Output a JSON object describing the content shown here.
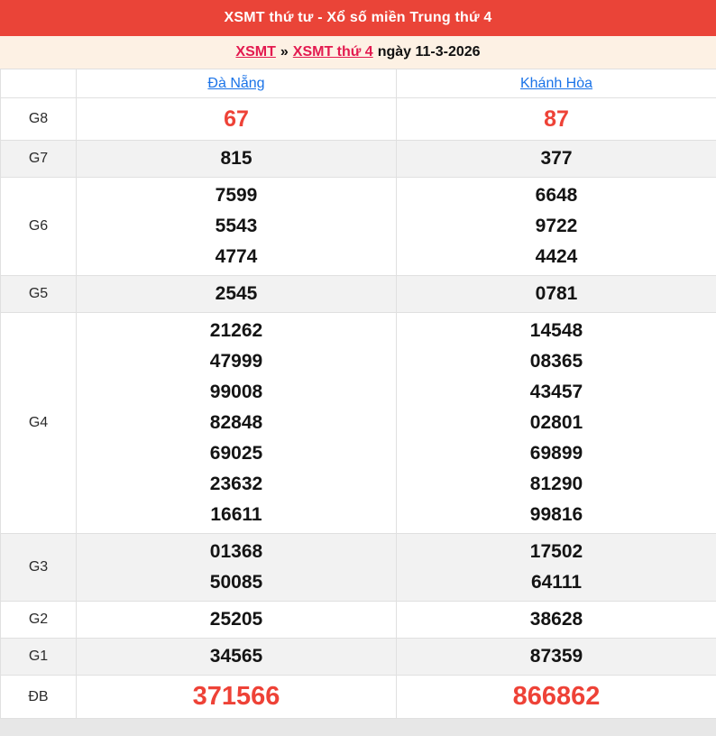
{
  "header": {
    "title": "XSMT thứ tư - Xổ số miền Trung thứ 4"
  },
  "breadcrumb": {
    "region_link": "XSMT",
    "separator": "»",
    "day_link": "XSMT thứ 4",
    "date_text": "ngày 11-3-2026"
  },
  "table": {
    "columns": [
      "Đà Nẵng",
      "Khánh Hòa"
    ],
    "rows": [
      {
        "id": "G8",
        "label": "G8",
        "red": true,
        "size": "large",
        "cells": [
          [
            "67"
          ],
          [
            "87"
          ]
        ]
      },
      {
        "id": "G7",
        "label": "G7",
        "red": false,
        "size": "normal",
        "cells": [
          [
            "815"
          ],
          [
            "377"
          ]
        ]
      },
      {
        "id": "G6",
        "label": "G6",
        "red": false,
        "size": "normal",
        "cells": [
          [
            "7599",
            "5543",
            "4774"
          ],
          [
            "6648",
            "9722",
            "4424"
          ]
        ]
      },
      {
        "id": "G5",
        "label": "G5",
        "red": false,
        "size": "normal",
        "cells": [
          [
            "2545"
          ],
          [
            "0781"
          ]
        ]
      },
      {
        "id": "G4",
        "label": "G4",
        "red": false,
        "size": "normal",
        "cells": [
          [
            "21262",
            "47999",
            "99008",
            "82848",
            "69025",
            "23632",
            "16611"
          ],
          [
            "14548",
            "08365",
            "43457",
            "02801",
            "69899",
            "81290",
            "99816"
          ]
        ]
      },
      {
        "id": "G3",
        "label": "G3",
        "red": false,
        "size": "normal",
        "cells": [
          [
            "01368",
            "50085"
          ],
          [
            "17502",
            "64111"
          ]
        ]
      },
      {
        "id": "G2",
        "label": "G2",
        "red": false,
        "size": "normal",
        "cells": [
          [
            "25205"
          ],
          [
            "38628"
          ]
        ]
      },
      {
        "id": "G1",
        "label": "G1",
        "red": false,
        "size": "normal",
        "cells": [
          [
            "34565"
          ],
          [
            "87359"
          ]
        ]
      },
      {
        "id": "DB",
        "label": "ĐB",
        "red": true,
        "size": "xlarge",
        "cells": [
          [
            "371566"
          ],
          [
            "866862"
          ]
        ]
      }
    ]
  },
  "colors": {
    "header_bg": "#ea4438",
    "header_text": "#ffffff",
    "breadcrumb_bg": "#fdf1e4",
    "breadcrumb_link": "#e31a4f",
    "breadcrumb_text": "#111111",
    "column_link": "#1a73e8",
    "number_text": "#141414",
    "number_red": "#ee4237",
    "row_alt_bg": "#f2f2f2",
    "border": "#e0e0e0",
    "page_bg": "#e7e7e7",
    "label_text": "#2b2b2b"
  }
}
